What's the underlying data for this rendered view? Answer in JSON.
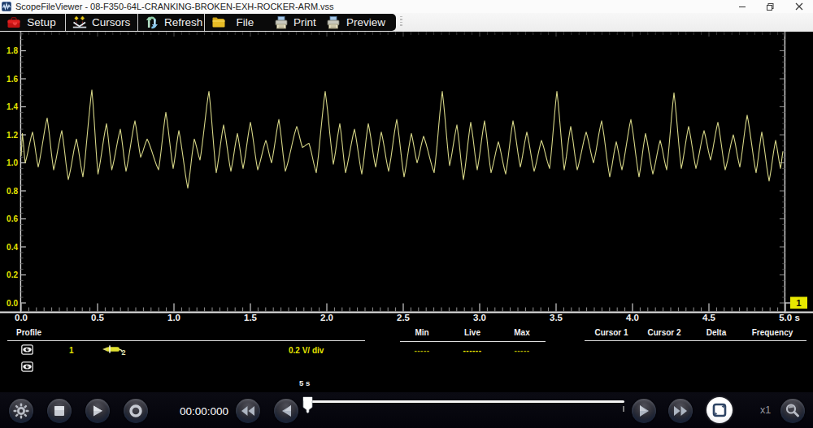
{
  "window": {
    "title": "ScopeFileViewer - 08-F350-64L-CRANKING-BROKEN-EXH-ROCKER-ARM.vss",
    "app_icon": "scope-logo-icon",
    "controls": [
      "minimize",
      "maximize",
      "close"
    ]
  },
  "toolbar": {
    "buttons": [
      {
        "label": "Setup",
        "icon": "toolbox-red-icon"
      },
      {
        "label": "Cursors",
        "icon": "cursors-icon"
      },
      {
        "label": "Refresh",
        "icon": "refresh-icon"
      },
      {
        "label": "File",
        "icon": "folder-yellow-icon"
      },
      {
        "label": "Print",
        "icon": "printer-icon"
      },
      {
        "label": "Preview",
        "icon": "print-preview-icon"
      }
    ]
  },
  "chart_data": {
    "type": "line",
    "title": "",
    "xlabel": "s",
    "ylabel": "V",
    "x_ticks": [
      "0.0",
      "0.5",
      "1.0",
      "1.5",
      "2.0",
      "2.5",
      "3.0",
      "3.5",
      "4.0",
      "4.5",
      "5.0 s"
    ],
    "y_ticks": [
      "0.0",
      "0.2",
      "0.4",
      "0.6",
      "0.8",
      "1.0",
      "1.2",
      "1.4",
      "1.6",
      "1.8"
    ],
    "xlim": [
      0,
      5
    ],
    "ylim": [
      0,
      1.936
    ],
    "x_minor_step": 0.05,
    "y_minor_step": 0.04,
    "grid": false,
    "legend_position": "none",
    "trace_color": "#d6d687",
    "axis_color": "#e2e2e2",
    "label_color": "#e4e400",
    "channel_marker": {
      "label": "1",
      "level": 0.0,
      "color": "#e8e800"
    },
    "series": [
      {
        "name": "Channel 1",
        "units": "V",
        "extrema": [
          [
            0.0,
            1.05
          ],
          [
            0.008,
            1.21
          ],
          [
            0.0266,
            1.0
          ],
          [
            0.0745,
            1.22
          ],
          [
            0.1117,
            0.97
          ],
          [
            0.1702,
            1.32
          ],
          [
            0.2128,
            0.95
          ],
          [
            0.266,
            1.23
          ],
          [
            0.3085,
            0.88
          ],
          [
            0.3617,
            1.17
          ],
          [
            0.4043,
            0.9
          ],
          [
            0.4628,
            1.52
          ],
          [
            0.5027,
            0.92
          ],
          [
            0.5585,
            1.28
          ],
          [
            0.5931,
            0.95
          ],
          [
            0.6489,
            1.24
          ],
          [
            0.6862,
            0.94
          ],
          [
            0.7447,
            1.3
          ],
          [
            0.7819,
            1.04
          ],
          [
            0.8245,
            1.17
          ],
          [
            0.8989,
            0.95
          ],
          [
            0.9468,
            1.36
          ],
          [
            0.9947,
            0.96
          ],
          [
            1.0319,
            1.23
          ],
          [
            1.0904,
            0.82
          ],
          [
            1.133,
            1.17
          ],
          [
            1.1702,
            1.02
          ],
          [
            1.2287,
            1.51
          ],
          [
            1.2766,
            0.93
          ],
          [
            1.3245,
            1.27
          ],
          [
            1.3723,
            0.94
          ],
          [
            1.4149,
            1.21
          ],
          [
            1.4521,
            0.96
          ],
          [
            1.5,
            1.29
          ],
          [
            1.5479,
            0.95
          ],
          [
            1.6011,
            1.16
          ],
          [
            1.6383,
            1.0
          ],
          [
            1.6862,
            1.31
          ],
          [
            1.7287,
            0.94
          ],
          [
            1.8032,
            1.26
          ],
          [
            1.8404,
            1.11
          ],
          [
            1.883,
            1.14
          ],
          [
            1.9309,
            0.93
          ],
          [
            1.9894,
            1.51
          ],
          [
            2.0426,
            0.99
          ],
          [
            2.0851,
            1.28
          ],
          [
            2.1223,
            0.93
          ],
          [
            2.1809,
            1.24
          ],
          [
            2.2287,
            0.92
          ],
          [
            2.2713,
            1.28
          ],
          [
            2.3191,
            0.97
          ],
          [
            2.3564,
            1.22
          ],
          [
            2.4043,
            0.94
          ],
          [
            2.4574,
            1.31
          ],
          [
            2.5053,
            0.9
          ],
          [
            2.5532,
            1.21
          ],
          [
            2.5904,
            1.0
          ],
          [
            2.633,
            1.19
          ],
          [
            2.7021,
            0.93
          ],
          [
            2.7553,
            1.51
          ],
          [
            2.8032,
            0.98
          ],
          [
            2.8511,
            1.27
          ],
          [
            2.8936,
            0.88
          ],
          [
            2.9415,
            1.29
          ],
          [
            2.984,
            0.95
          ],
          [
            3.0319,
            1.3
          ],
          [
            3.0745,
            0.93
          ],
          [
            3.1223,
            1.15
          ],
          [
            3.1702,
            0.92
          ],
          [
            3.2181,
            1.3
          ],
          [
            3.266,
            0.97
          ],
          [
            3.3085,
            1.22
          ],
          [
            3.3564,
            0.94
          ],
          [
            3.4043,
            1.16
          ],
          [
            3.4574,
            0.96
          ],
          [
            3.5053,
            1.51
          ],
          [
            3.5532,
            0.95
          ],
          [
            3.5957,
            1.26
          ],
          [
            3.6383,
            0.95
          ],
          [
            3.6968,
            1.22
          ],
          [
            3.7447,
            1.0
          ],
          [
            3.7979,
            1.3
          ],
          [
            3.8511,
            0.9
          ],
          [
            3.8936,
            1.15
          ],
          [
            3.9309,
            0.95
          ],
          [
            3.9894,
            1.31
          ],
          [
            4.0426,
            0.9
          ],
          [
            4.0851,
            1.21
          ],
          [
            4.133,
            0.92
          ],
          [
            4.1809,
            1.16
          ],
          [
            4.2234,
            0.95
          ],
          [
            4.2713,
            1.5
          ],
          [
            4.3191,
            0.96
          ],
          [
            4.367,
            1.26
          ],
          [
            4.4149,
            0.96
          ],
          [
            4.4681,
            1.23
          ],
          [
            4.5106,
            1.02
          ],
          [
            4.5585,
            1.29
          ],
          [
            4.6064,
            0.95
          ],
          [
            4.6596,
            1.2
          ],
          [
            4.7021,
            0.97
          ],
          [
            4.75,
            1.34
          ],
          [
            4.8085,
            0.93
          ],
          [
            4.8457,
            1.22
          ],
          [
            4.8936,
            0.87
          ],
          [
            4.9362,
            1.16
          ],
          [
            4.9681,
            0.96
          ],
          [
            4.984,
            1.08
          ]
        ]
      }
    ]
  },
  "panel": {
    "profile_label": "Profile",
    "value_columns": [
      "Min",
      "Live",
      "Max"
    ],
    "cursor_columns": [
      "Cursor 1",
      "Cursor 2",
      "Delta",
      "Frequency"
    ],
    "rows": [
      {
        "visible_icon": "eye-icon",
        "channel": "1",
        "probe_icon": "probe-2-icon",
        "scale": "0.2 V/ div",
        "min": "-----",
        "live": "------",
        "max": "-----"
      },
      {
        "visible_icon": "eye-icon"
      }
    ]
  },
  "transport": {
    "time_display": "00:00:000",
    "range_label": "5 s",
    "zoom_label": "x1",
    "buttons": [
      "settings-gear-icon",
      "stop-icon",
      "play-icon",
      "record-icon",
      "fast-rewind-icon",
      "step-back-icon",
      "step-forward-icon",
      "fast-forward-icon",
      "fit-screen-icon",
      "zoom-magnifier-icon"
    ],
    "slider": {
      "value_frac": 0.0
    }
  }
}
